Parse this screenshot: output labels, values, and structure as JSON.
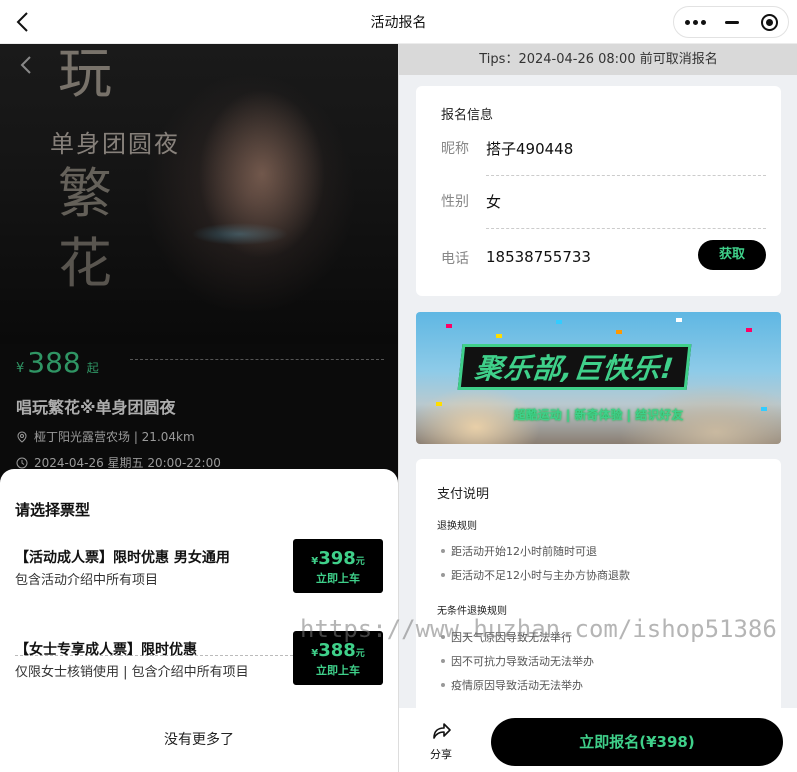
{
  "header": {
    "title": "活动报名"
  },
  "poster": {
    "text_top": "玩",
    "text_sub": "单身团圆夜",
    "text_mid": "繁",
    "text_bottom": "花"
  },
  "event": {
    "yen": "¥",
    "price": "388",
    "price_suffix": "起",
    "name": "唱玩繁花※单身团圆夜",
    "location": "桠丁阳光露营农场 | 21.04km",
    "time": "2024-04-26 星期五 20:00-22:00"
  },
  "ticket_sheet": {
    "title": "请选择票型",
    "tickets": [
      {
        "name": "【活动成人票】限时优惠 男女通用",
        "desc": "包含活动介绍中所有项目",
        "yen": "¥",
        "price": "398",
        "unit": "元",
        "action": "立即上车"
      },
      {
        "name": "【女士专享成人票】限时优惠",
        "desc": "仅限女士核销使用 | 包含介绍中所有项目",
        "yen": "¥",
        "price": "388",
        "unit": "元",
        "action": "立即上车"
      }
    ],
    "no_more": "没有更多了"
  },
  "tips": "Tips：2024-04-26 08:00 前可取消报名",
  "signup_info": {
    "title": "报名信息",
    "nickname_label": "昵称",
    "nickname": "搭子490448",
    "gender_label": "性别",
    "gender": "女",
    "phone_label": "电话",
    "phone": "18538755733",
    "get_button": "获取"
  },
  "banner": {
    "slogan": "聚乐部,巨快乐!",
    "tags": "超酷运动 | 新奇体验 | 结识好友"
  },
  "payment": {
    "title": "支付说明",
    "refund_rules_title": "退换规则",
    "refund_rules": [
      "距活动开始12小时前随时可退",
      "距活动不足12小时与主办方协商退款"
    ],
    "unconditional_title": "无条件退换规则",
    "unconditional": [
      "因天气原因导致无法举行",
      "因不可抗力导致活动无法举办",
      "疫情原因导致活动无法举办"
    ]
  },
  "watermark": "https://www.huzhan.com/ishop51386",
  "bottom": {
    "share": "分享",
    "signup": "立即报名(¥398)"
  },
  "colors": {
    "accent": "#3fd08a",
    "dark": "#000000"
  }
}
